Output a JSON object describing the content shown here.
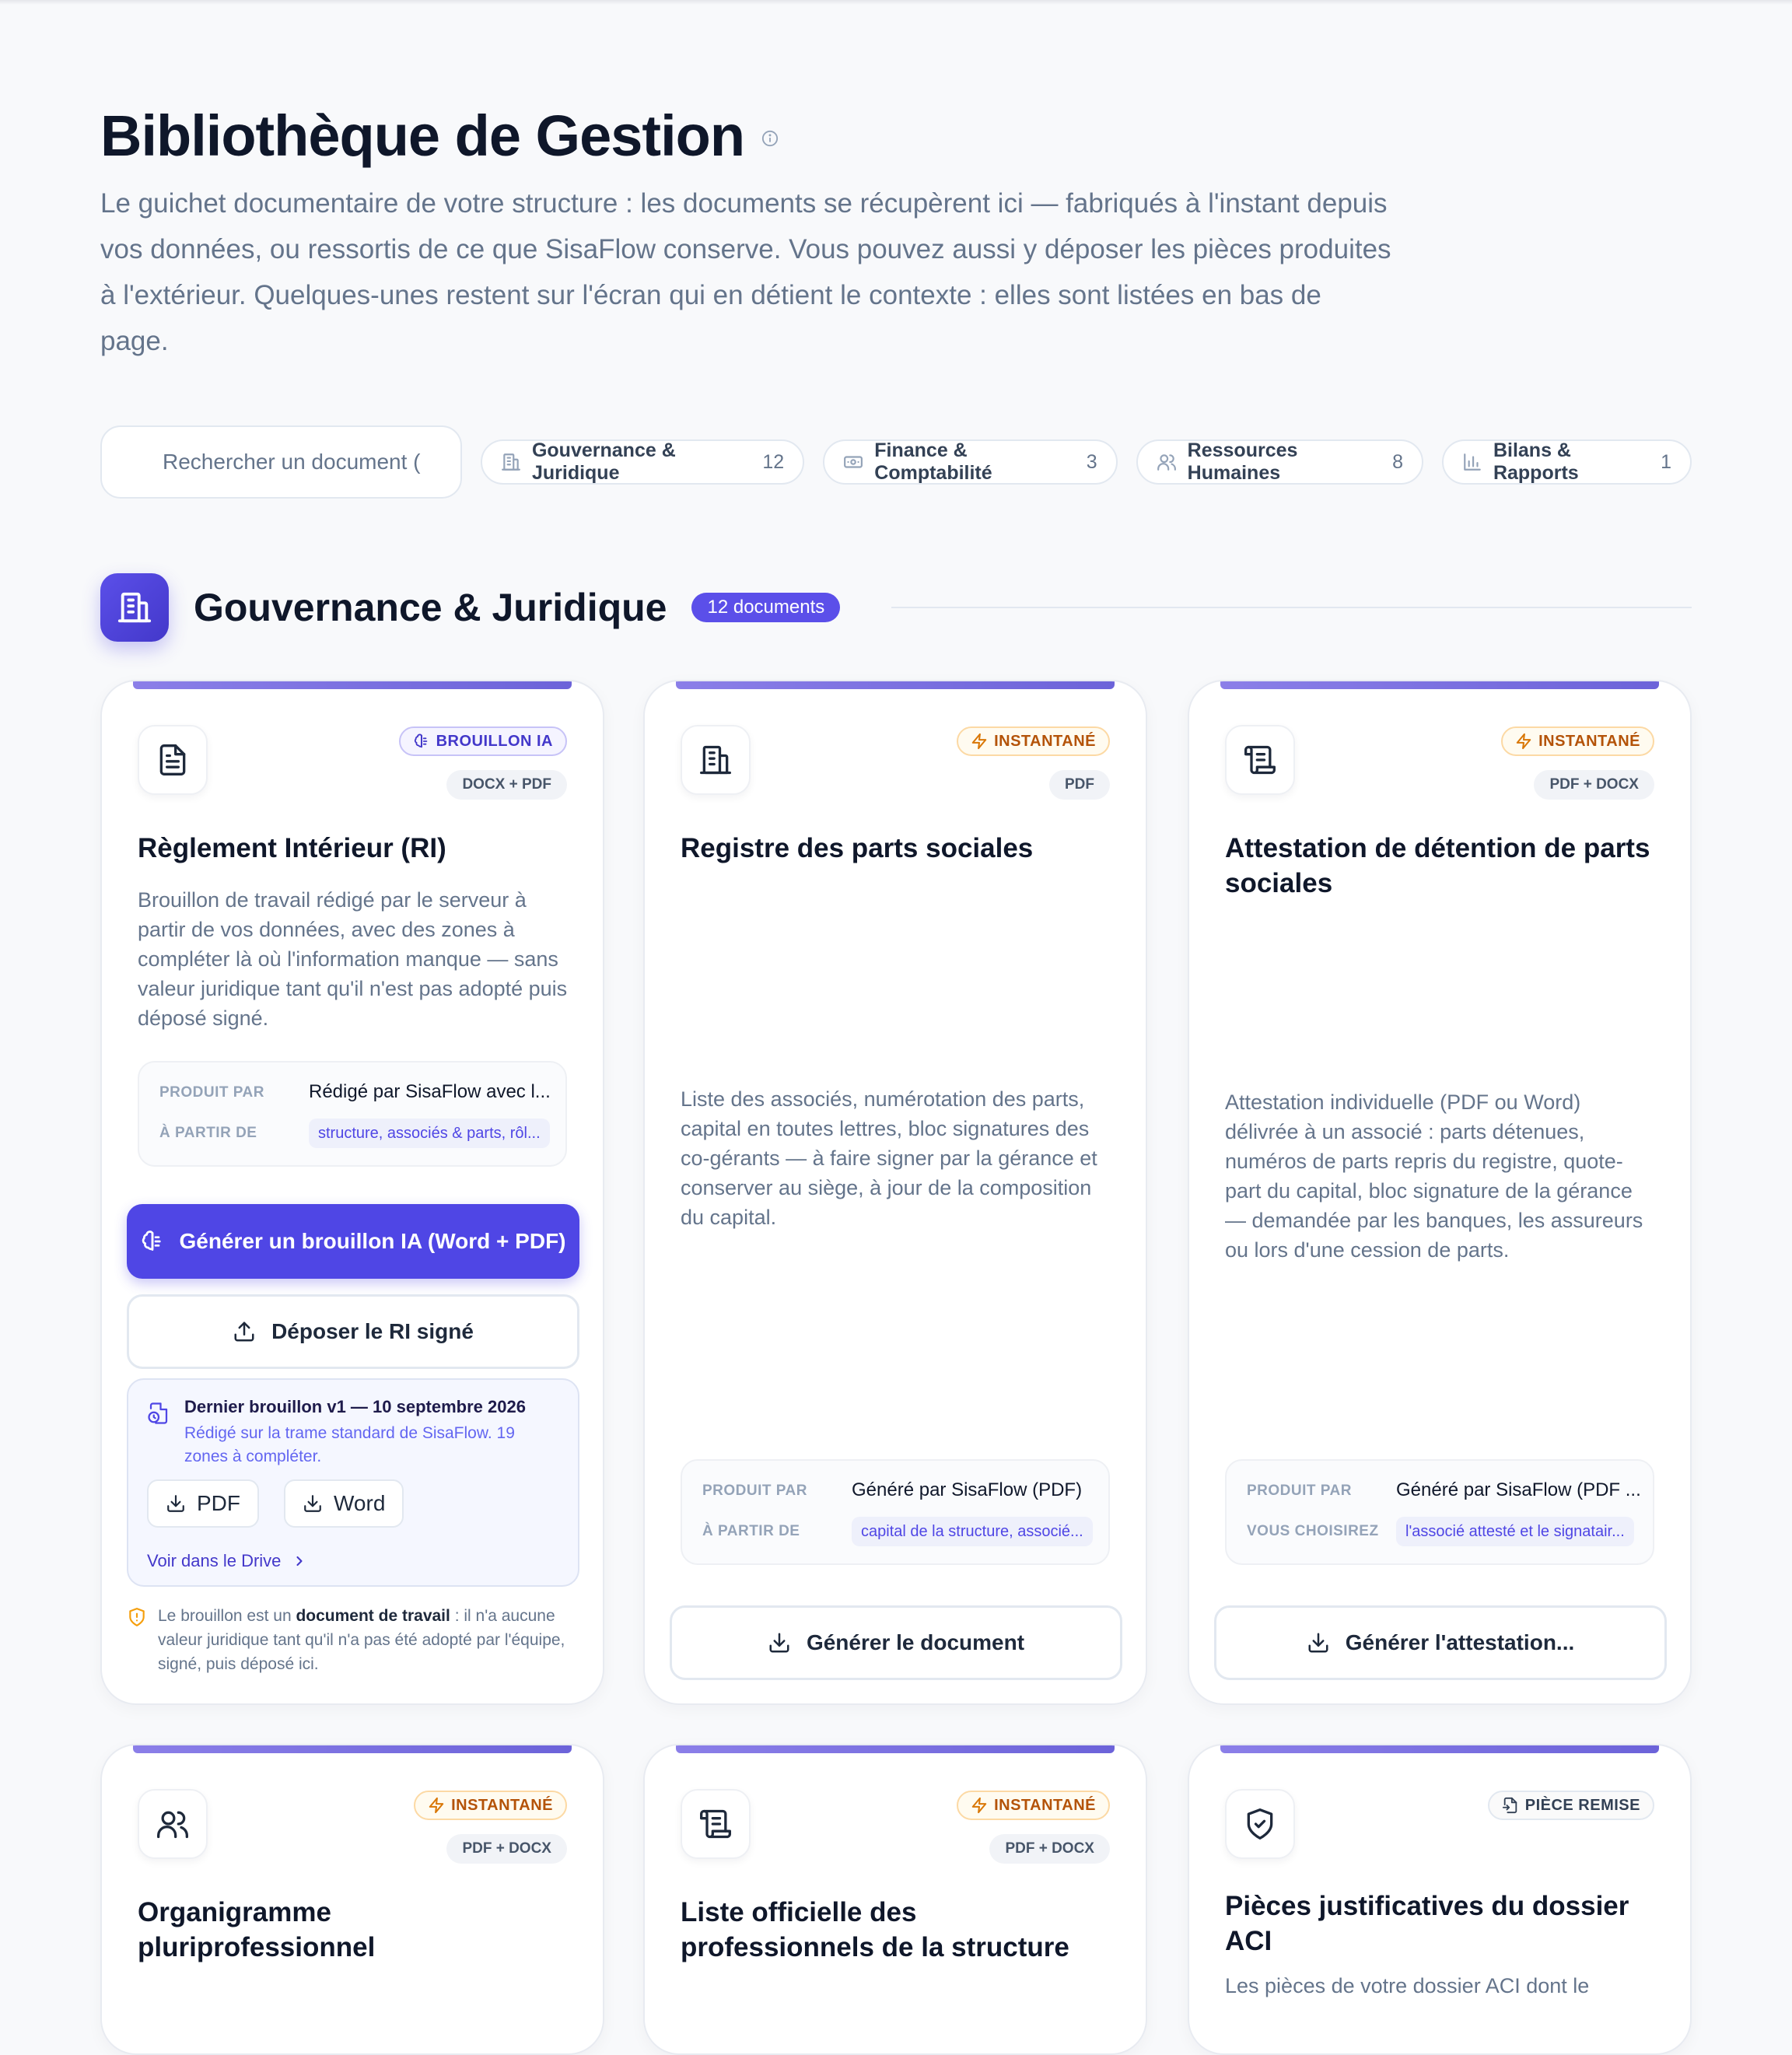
{
  "header": {
    "title": "Bibliothèque de Gestion",
    "subtitle": "Le guichet documentaire de votre structure : les documents se récupèrent ici — fabriqués à l'instant depuis vos données, ou ressortis de ce que SisaFlow conserve. Vous pouvez aussi y déposer les pièces produites à l'extérieur. Quelques-unes restent sur l'écran qui en détient le contexte : elles sont listées en bas de page."
  },
  "search": {
    "placeholder": "Rechercher un document ("
  },
  "filters": [
    {
      "label": "Gouvernance & Juridique",
      "count": "12",
      "icon": "building-icon"
    },
    {
      "label": "Finance & Comptabilité",
      "count": "3",
      "icon": "banknote-icon"
    },
    {
      "label": "Ressources Humaines",
      "count": "8",
      "icon": "users-icon"
    },
    {
      "label": "Bilans & Rapports",
      "count": "1",
      "icon": "bar-chart-icon"
    }
  ],
  "section": {
    "title": "Gouvernance & Juridique",
    "badge": "12 documents",
    "icon": "building-icon"
  },
  "cards": [
    {
      "icon": "file-text-icon",
      "badge": "BROUILLON IA",
      "formats": "DOCX + PDF",
      "title": "Règlement Intérieur (RI)",
      "description": "Brouillon de travail rédigé par le serveur à partir de vos données, avec des zones à compléter là où l'information manque — sans valeur juridique tant qu'il n'est pas adopté puis déposé signé.",
      "meta": {
        "k1": "PRODUIT PAR",
        "v1": "Rédigé par SisaFlow avec l...",
        "k2": "À PARTIR DE",
        "v2": "structure, associés & parts, rôl..."
      },
      "primary_button": "Générer un brouillon IA (Word + PDF)",
      "secondary_button": "Déposer le RI signé",
      "draft": {
        "title": "Dernier brouillon v1 — 10 septembre 2026",
        "subtitle": "Rédigé sur la trame standard de SisaFlow. 19 zones à compléter.",
        "pdf": "PDF",
        "word": "Word",
        "drive": "Voir dans le Drive"
      },
      "note_prefix": "Le brouillon est un ",
      "note_bold": "document de travail",
      "note_suffix": " : il n'a aucune valeur juridique tant qu'il n'a pas été adopté par l'équipe, signé, puis déposé ici."
    },
    {
      "icon": "building-icon",
      "badge": "INSTANTANÉ",
      "formats": "PDF",
      "title": "Registre des parts sociales",
      "description": "Liste des associés, numérotation des parts, capital en toutes lettres, bloc signatures des co-gérants — à faire signer par la gérance et conserver au siège, à jour de la composition du capital.",
      "meta": {
        "k1": "PRODUIT PAR",
        "v1": "Généré par SisaFlow (PDF)",
        "k2": "À PARTIR DE",
        "v2": "capital de la structure, associé..."
      },
      "button": "Générer le document"
    },
    {
      "icon": "scroll-icon",
      "badge": "INSTANTANÉ",
      "formats": "PDF + DOCX",
      "title": "Attestation de détention de parts sociales",
      "description": "Attestation individuelle (PDF ou Word) délivrée à un associé : parts détenues, numéros de parts repris du registre, quote-part du capital, bloc signature de la gérance — demandée par les banques, les assureurs ou lors d'une cession de parts.",
      "meta": {
        "k1": "PRODUIT PAR",
        "v1": "Généré par SisaFlow (PDF ...",
        "k2": "VOUS CHOISIREZ",
        "v2": "l'associé attesté et le signatair..."
      },
      "button": "Générer l'attestation..."
    },
    {
      "icon": "users-icon",
      "badge": "INSTANTANÉ",
      "formats": "PDF + DOCX",
      "title": "Organigramme pluriprofessionnel"
    },
    {
      "icon": "scroll-icon",
      "badge": "INSTANTANÉ",
      "formats": "PDF + DOCX",
      "title": "Liste officielle des professionnels de la structure"
    },
    {
      "icon": "shield-check-icon",
      "badge": "PIÈCE REMISE",
      "title": "Pièces justificatives du dossier ACI",
      "description": "Les pièces de votre dossier ACI dont le"
    }
  ]
}
